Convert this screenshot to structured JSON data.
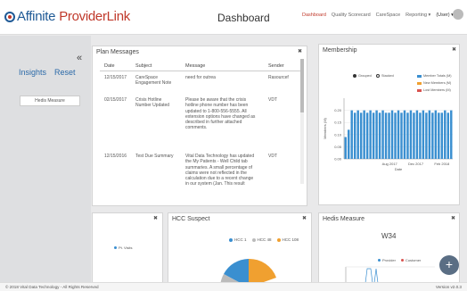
{
  "app": {
    "logo_affinite": "Affinite",
    "logo_provider": "ProviderLink",
    "page_title": "Dashboard"
  },
  "nav": {
    "items": [
      "Dashboard",
      "Quality Scorecard",
      "CareSpace",
      "Reporting ▾",
      "(User) ▾"
    ],
    "active": "Dashboard"
  },
  "sidebar": {
    "collapse": "«",
    "tabs": [
      "Insights",
      "Reset"
    ],
    "items": [
      "Hedis Measure"
    ]
  },
  "plan_messages": {
    "title": "Plan Messages",
    "pin": "✖",
    "columns": [
      "Date",
      "Subject",
      "Message",
      "Sender"
    ],
    "rows": [
      {
        "date": "12/15/2017",
        "subject": [
          "CareSpace",
          "Engagement Note"
        ],
        "message": [
          "need for outrea"
        ],
        "sender": "Rasourcef"
      },
      {
        "date": "02/15/2017",
        "subject": [
          "Crisis Hotline",
          "Number Updated"
        ],
        "message": [
          "Please be aware that the crisis",
          "hotline phone number has been",
          "updated to 1-800-556-5555. All",
          "extension options have changed as",
          "described in further attached",
          "comments."
        ],
        "sender": "VDT"
      },
      {
        "date": "12/15/2016",
        "subject": [
          "Test Due Summary"
        ],
        "message": [
          "Vital Data Technology has updated",
          "the My Patients - Well Child tab",
          "summaries. A small percentage of",
          "claims were not reflected in the",
          "calculation due to a recent change",
          "in our system (Jan. This result"
        ],
        "sender": "VDT"
      }
    ]
  },
  "membership": {
    "title": "Membership",
    "pin": "✖",
    "legend_left": [
      "Grouped",
      "Stacked"
    ],
    "legend_right": [
      "Member Totals (M)",
      "New Members (M)",
      "Lost Members (M)"
    ],
    "colors": {
      "total": "#3a8fd0",
      "new": "#f0a030",
      "lost": "#d9534f"
    },
    "chart_data": {
      "type": "bar",
      "ylabel": "Members (M)",
      "xlabel": "Date",
      "x_ticks": [
        "Aug 2017",
        "Dec 2017",
        "Feb 2018"
      ],
      "y_ticks": [
        "0.00",
        "0.05",
        "0.10",
        "0.15",
        "0.20"
      ],
      "ylim": [
        0,
        0.25
      ],
      "series": [
        {
          "name": "Member Totals (M)",
          "values": [
            0.09,
            0.12,
            0.2,
            0.19,
            0.2,
            0.19,
            0.2,
            0.19,
            0.2,
            0.19,
            0.2,
            0.19,
            0.2,
            0.19,
            0.19,
            0.2,
            0.19,
            0.2,
            0.19,
            0.2,
            0.19,
            0.2,
            0.19,
            0.2,
            0.19,
            0.2,
            0.19,
            0.2,
            0.19,
            0.2,
            0.19,
            0.19,
            0.2,
            0.19,
            0.2
          ]
        }
      ]
    }
  },
  "bottom_left": {
    "pin": "✖",
    "legend": "Pt. Visits"
  },
  "hcc": {
    "title": "HCC Suspect",
    "pin": "✖",
    "legend": [
      "HCC 1",
      "HCC 48",
      "HCC 108"
    ],
    "colors": [
      "#3a8fd0",
      "#bbbbbb",
      "#f0a030"
    ]
  },
  "hedis": {
    "title": "Hedis Measure",
    "pin": "✖",
    "subtitle": "W34",
    "legend": [
      "Provider",
      "Customer"
    ],
    "colors": [
      "#3a8fd0",
      "#d9534f"
    ]
  },
  "footer": {
    "copyright": "© 2018 Vital Data Technology - All Rights Reserved",
    "version": "Version v2.0.3"
  },
  "fab": {
    "label": "+"
  }
}
